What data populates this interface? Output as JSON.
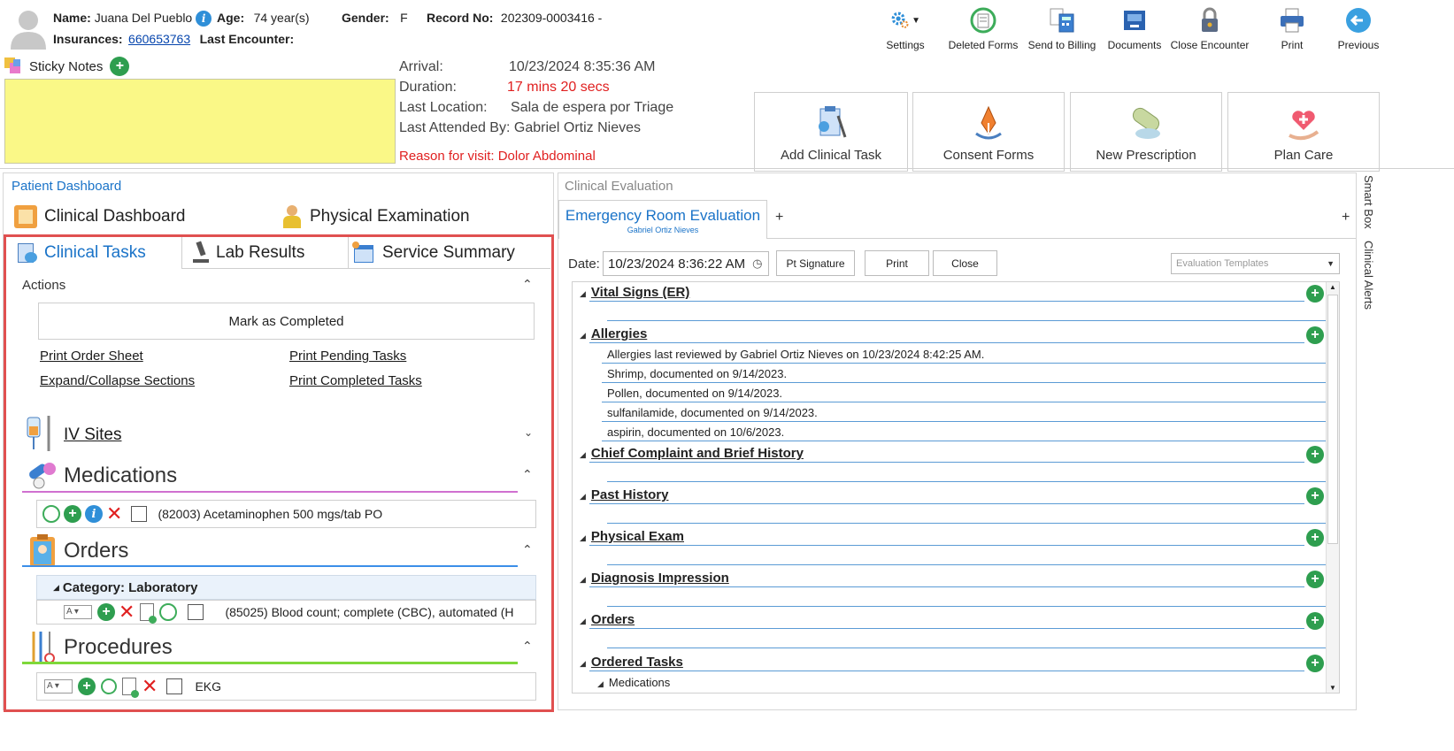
{
  "patient": {
    "name_label": "Name:",
    "name": "Juana Del Pueblo",
    "age_label": "Age:",
    "age": "74 year(s)",
    "gender_label": "Gender:",
    "gender": "F",
    "record_label": "Record No:",
    "record": "202309-0003416 -",
    "insurances_label": "Insurances:",
    "insurance": "660653763",
    "last_encounter_label": "Last Encounter:"
  },
  "toolbar": {
    "settings": "Settings",
    "deleted_forms": "Deleted Forms",
    "send_to_billing": "Send to Billing",
    "documents": "Documents",
    "close_encounter": "Close Encounter",
    "print": "Print",
    "previous": "Previous"
  },
  "sticky": {
    "label": "Sticky Notes"
  },
  "visit": {
    "arrival_label": "Arrival:",
    "arrival": "10/23/2024 8:35:36 AM",
    "duration_label": "Duration:",
    "duration": "17 mins 20 secs",
    "location_label": "Last Location:",
    "location": "Sala de espera por Triage",
    "attended": "Last Attended By: Gabriel Ortiz Nieves",
    "reason": "Reason for visit: Dolor Abdominal"
  },
  "big_buttons": {
    "add_task": "Add Clinical Task",
    "consent": "Consent Forms",
    "prescription": "New Prescription",
    "plan_care": "Plan Care"
  },
  "left": {
    "dashboard_title": "Patient Dashboard",
    "tab_clinical_dashboard": "Clinical Dashboard",
    "tab_physical_exam": "Physical Examination",
    "tab_clinical_tasks": "Clinical Tasks",
    "tab_lab_results": "Lab Results",
    "tab_service_summary": "Service Summary",
    "actions_label": "Actions",
    "mark_completed": "Mark as Completed",
    "print_order_sheet": "Print Order Sheet",
    "print_pending": "Print Pending Tasks",
    "expand_collapse": "Expand/Collapse Sections",
    "print_completed": "Print Completed Tasks",
    "iv_sites": "IV Sites",
    "medications": "Medications",
    "medication_item": "(82003) Acetaminophen 500 mgs/tab PO",
    "orders": "Orders",
    "category": "Category: Laboratory",
    "order_item": "(85025) Blood count; complete (CBC), automated (H",
    "procedures": "Procedures",
    "procedure_item": "EKG"
  },
  "right": {
    "title": "Clinical Evaluation",
    "tab_title": "Emergency Room Evaluation",
    "tab_sub": "Gabriel Ortiz Nieves",
    "tab_add": "+",
    "date_label": "Date:",
    "date_value": "10/23/2024 8:36:22 AM",
    "pt_signature": "Pt Signature",
    "print": "Print",
    "close": "Close",
    "templates_placeholder": "Evaluation Templates",
    "sections": {
      "vital_signs": "Vital Signs (ER)",
      "allergies": "Allergies",
      "chief": "Chief Complaint and Brief History",
      "past": "Past History",
      "physical": "Physical Exam",
      "diagnosis": "Diagnosis Impression",
      "orders": "Orders",
      "ordered_tasks": "Ordered Tasks",
      "medications_sub": "Medications"
    },
    "allergy_rows": [
      "Allergies last reviewed by Gabriel Ortiz Nieves on 10/23/2024 8:42:25 AM.",
      "Shrimp, documented on 9/14/2023.",
      "Pollen, documented on 9/14/2023.",
      "sulfanilamide, documented on 9/14/2023.",
      "aspirin, documented on 10/6/2023."
    ]
  },
  "side": {
    "smart_box": "Smart Box",
    "clinical_alerts": "Clinical Alerts"
  },
  "colors": {
    "sticky_bg": "#faf887",
    "highlight_border": "#e05050",
    "link_blue": "#1a73c8",
    "red_text": "#e02020",
    "medications_line": "#d070d0",
    "orders_line": "#3b8ee8",
    "procedures_line": "#7ed83a"
  }
}
